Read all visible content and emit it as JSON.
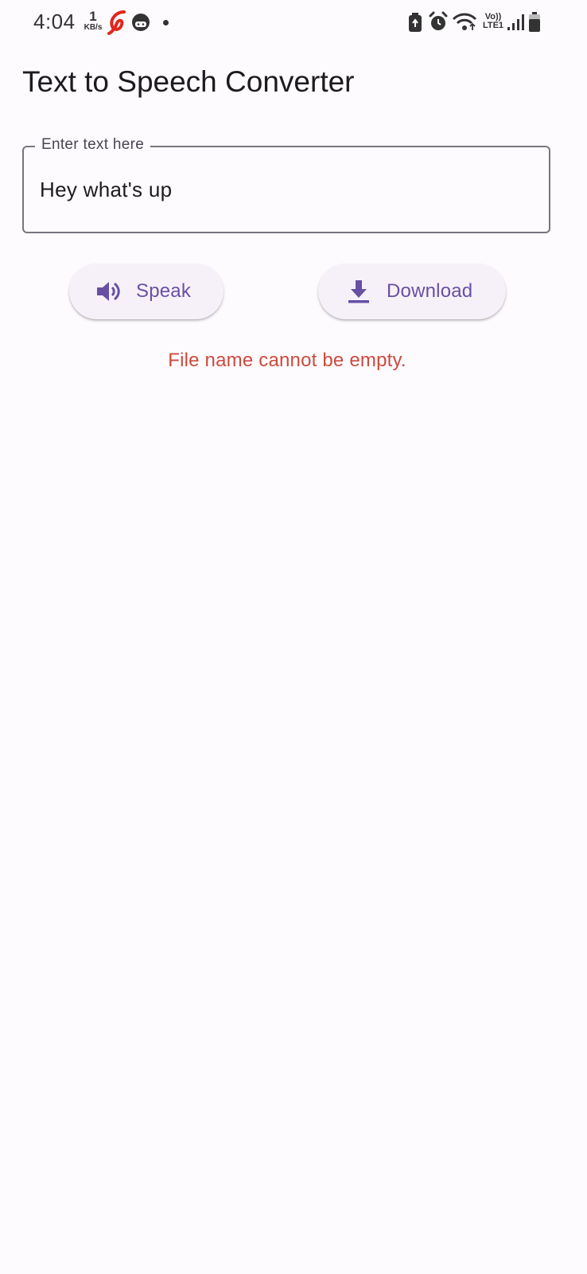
{
  "status_bar": {
    "time": "4:04",
    "speed_value": "1",
    "speed_unit": "KB/s",
    "volte_top": "Vo))",
    "volte_bottom": "LTE1"
  },
  "app": {
    "title": "Text to Speech Converter"
  },
  "text_field": {
    "label": "Enter text here",
    "value": "Hey what's up"
  },
  "buttons": {
    "speak_label": "Speak",
    "download_label": "Download"
  },
  "error": {
    "message": "File name cannot be empty."
  },
  "colors": {
    "accent": "#6750a4",
    "error": "#cc4a3e",
    "background": "#fefbff"
  }
}
